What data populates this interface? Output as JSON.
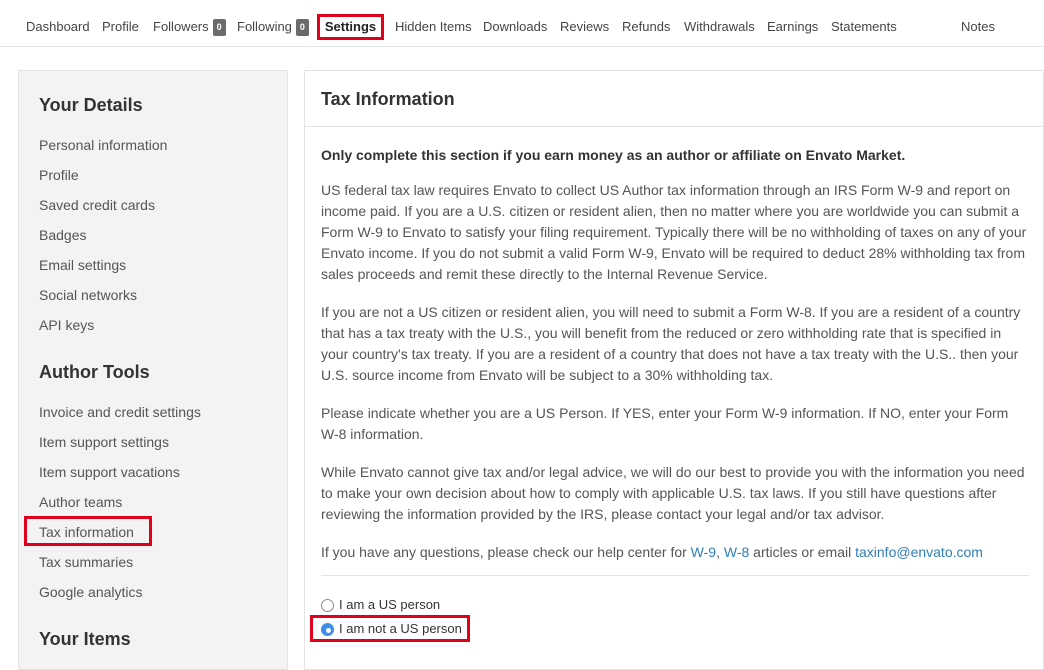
{
  "topnav": {
    "items": [
      {
        "label": "Dashboard"
      },
      {
        "label": "Profile"
      },
      {
        "label": "Followers",
        "badge": "0"
      },
      {
        "label": "Following",
        "badge": "0"
      },
      {
        "label": "Settings",
        "active": true
      },
      {
        "label": "Hidden Items"
      },
      {
        "label": "Downloads"
      },
      {
        "label": "Reviews"
      },
      {
        "label": "Refunds"
      },
      {
        "label": "Withdrawals"
      },
      {
        "label": "Earnings"
      },
      {
        "label": "Statements"
      },
      {
        "label": "Notes"
      }
    ]
  },
  "sidebar": {
    "sections": [
      {
        "heading": "Your Details",
        "links": [
          "Personal information",
          "Profile",
          "Saved credit cards",
          "Badges",
          "Email settings",
          "Social networks",
          "API keys"
        ]
      },
      {
        "heading": "Author Tools",
        "links": [
          "Invoice and credit settings",
          "Item support settings",
          "Item support vacations",
          "Author teams",
          "Tax information",
          "Tax summaries",
          "Google analytics"
        ]
      },
      {
        "heading": "Your Items",
        "links": []
      }
    ],
    "active_link": "Tax information"
  },
  "main": {
    "title": "Tax Information",
    "lead": "Only complete this section if you earn money as an author or affiliate on Envato Market.",
    "paragraphs": [
      "US federal tax law requires Envato to collect US Author tax information through an IRS Form W-9 and report on income paid. If you are a U.S. citizen or resident alien, then no matter where you are worldwide you can submit a Form W-9 to Envato to satisfy your filing requirement. Typically there will be no withholding of taxes on any of your Envato income. If you do not submit a valid Form W-9, Envato will be required to deduct 28% withholding tax from sales proceeds and remit these directly to the Internal Revenue Service.",
      "If you are not a US citizen or resident alien, you will need to submit a Form W-8. If you are a resident of a country that has a tax treaty with the U.S., you will benefit from the reduced or zero withholding rate that is specified in your country's tax treaty. If you are a resident of a country that does not have a tax treaty with the U.S.. then your U.S. source income from Envato will be subject to a 30% withholding tax.",
      "Please indicate whether you are a US Person. If YES, enter your Form W-9 information. If NO, enter your Form W-8 information.",
      "While Envato cannot give tax and/or legal advice, we will do our best to provide you with the information you need to make your own decision about how to comply with applicable U.S. tax laws. If you still have questions after reviewing the information provided by the IRS, please contact your legal and/or tax advisor."
    ],
    "help": {
      "prefix": "If you have any questions, please check our help center for ",
      "link_w9": "W-9",
      "sep": ", ",
      "link_w8": "W-8",
      "middle": " articles or email ",
      "email": "taxinfo@envato.com"
    },
    "radios": [
      {
        "label": "I am a US person",
        "checked": false
      },
      {
        "label": "I am not a US person",
        "checked": true
      }
    ]
  }
}
